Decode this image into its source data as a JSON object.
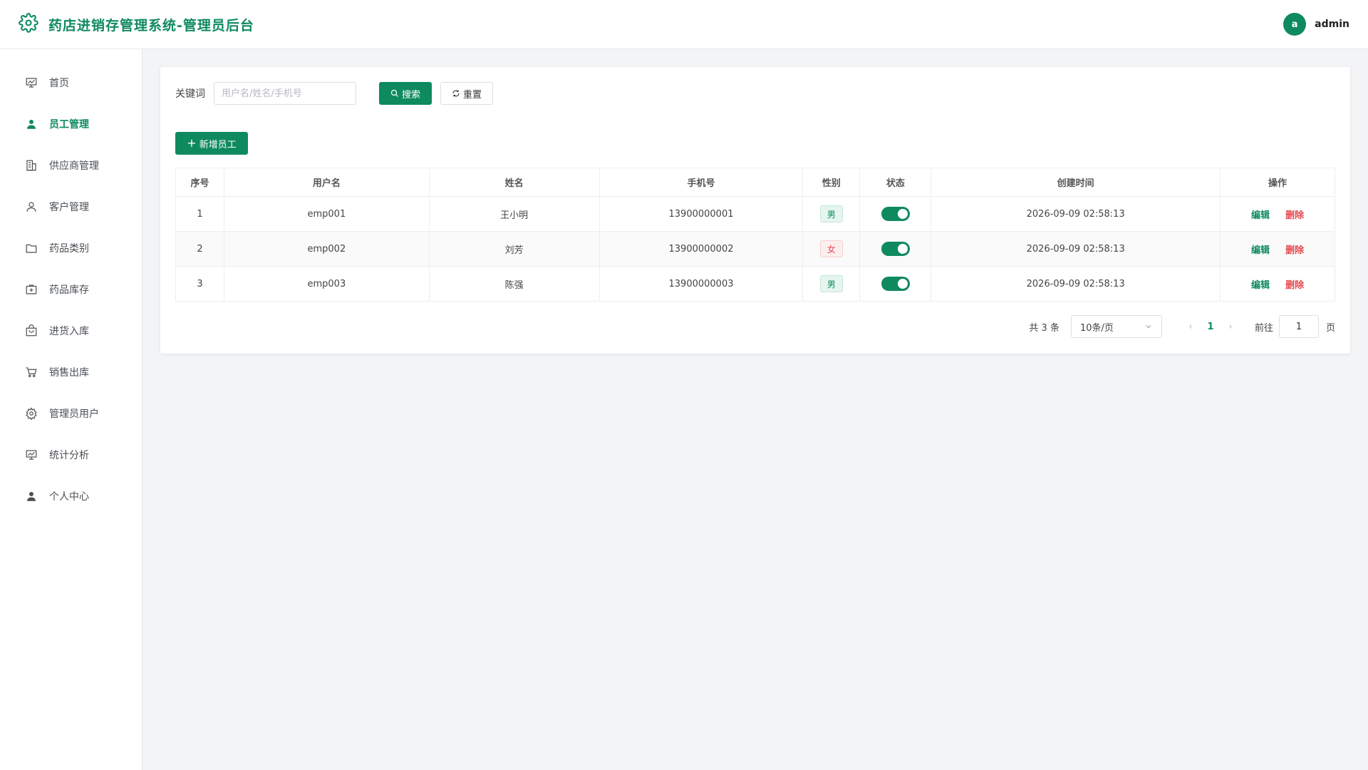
{
  "header": {
    "title": "药店进销存管理系统-管理员后台",
    "avatar_letter": "a",
    "username": "admin"
  },
  "sidebar": {
    "items": [
      {
        "label": "首页",
        "icon": "chart-board-icon",
        "active": false
      },
      {
        "label": "员工管理",
        "icon": "user-filled-icon",
        "active": true
      },
      {
        "label": "供应商管理",
        "icon": "building-icon",
        "active": false
      },
      {
        "label": "客户管理",
        "icon": "user-outline-icon",
        "active": false
      },
      {
        "label": "药品类别",
        "icon": "folder-icon",
        "active": false
      },
      {
        "label": "药品库存",
        "icon": "first-aid-kit-icon",
        "active": false
      },
      {
        "label": "进货入库",
        "icon": "shopping-bag-icon",
        "active": false
      },
      {
        "label": "销售出库",
        "icon": "cart-icon",
        "active": false
      },
      {
        "label": "管理员用户",
        "icon": "gear-icon",
        "active": false
      },
      {
        "label": "统计分析",
        "icon": "chart-board-icon",
        "active": false
      },
      {
        "label": "个人中心",
        "icon": "user-filled-icon",
        "active": false
      }
    ]
  },
  "search": {
    "label": "关键词",
    "placeholder": "用户名/姓名/手机号",
    "value": "",
    "search_label": "搜索",
    "reset_label": "重置"
  },
  "toolbar": {
    "add_label": "新增员工"
  },
  "table": {
    "columns": [
      "序号",
      "用户名",
      "姓名",
      "手机号",
      "性别",
      "状态",
      "创建时间",
      "操作"
    ],
    "rows": [
      {
        "index": "1",
        "username": "emp001",
        "name": "王小明",
        "phone": "13900000001",
        "gender": "男",
        "enabled": true,
        "created": "2026-09-09 02:58:13"
      },
      {
        "index": "2",
        "username": "emp002",
        "name": "刘芳",
        "phone": "13900000002",
        "gender": "女",
        "enabled": true,
        "created": "2026-09-09 02:58:13"
      },
      {
        "index": "3",
        "username": "emp003",
        "name": "陈强",
        "phone": "13900000003",
        "gender": "男",
        "enabled": true,
        "created": "2026-09-09 02:58:13"
      }
    ],
    "edit_label": "编辑",
    "delete_label": "删除"
  },
  "pager": {
    "total": "共 3 条",
    "page_size": "10条/页",
    "current_page": "1",
    "goto_label": "前往",
    "goto_value": "1",
    "goto_suffix": "页"
  },
  "colors": {
    "primary": "#0f8a5f",
    "danger": "#e5484d"
  }
}
